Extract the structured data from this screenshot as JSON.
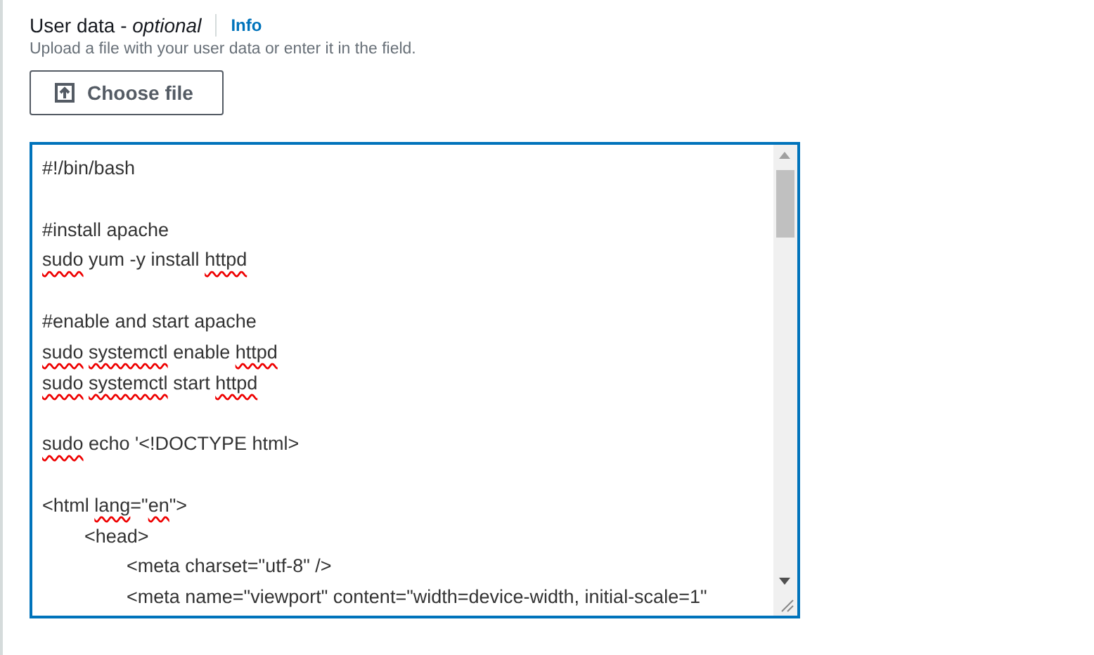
{
  "field": {
    "label": "User data - ",
    "label_optional": "optional",
    "info_link": "Info",
    "description": "Upload a file with your user data or enter it in the field.",
    "choose_button": "Choose file",
    "focused": true
  },
  "editor_lines": [
    {
      "segments": [
        {
          "text": "#!/bin/bash"
        }
      ]
    },
    {
      "space_before": true,
      "segments": [
        {
          "text": "#install apache"
        }
      ]
    },
    {
      "segments": [
        {
          "text": "sudo",
          "misspelled": true
        },
        {
          "text": " yum -y install "
        },
        {
          "text": "httpd",
          "misspelled": true
        }
      ]
    },
    {
      "space_before": true,
      "segments": [
        {
          "text": "#enable and start apache"
        }
      ]
    },
    {
      "segments": [
        {
          "text": "sudo ",
          "misspelled": true
        },
        {
          "text": "systemctl",
          "misspelled": true
        },
        {
          "text": " enable "
        },
        {
          "text": "httpd",
          "misspelled": true
        }
      ]
    },
    {
      "segments": [
        {
          "text": "sudo ",
          "misspelled": true
        },
        {
          "text": "systemctl",
          "misspelled": true
        },
        {
          "text": " start "
        },
        {
          "text": "httpd",
          "misspelled": true
        }
      ]
    },
    {
      "space_before": true,
      "segments": [
        {
          "text": "sudo",
          "misspelled": true
        },
        {
          "text": " echo '<!DOCTYPE html>"
        }
      ]
    },
    {
      "space_before": true,
      "segments": [
        {
          "text": "<html "
        },
        {
          "text": "lang",
          "misspelled": true
        },
        {
          "text": "=\""
        },
        {
          "text": "en",
          "misspelled": true
        },
        {
          "text": "\">"
        }
      ],
      "children": [
        {
          "segments": [
            {
              "text": "<head>"
            }
          ],
          "children": [
            {
              "segments": [
                {
                  "text": "<meta charset=\"utf-8\" />"
                }
              ]
            },
            {
              "segments": [
                {
                  "text": "<meta name=\"viewport\" content=\"width=device-width, initial-scale=1\""
                }
              ]
            }
          ]
        }
      ]
    }
  ]
}
